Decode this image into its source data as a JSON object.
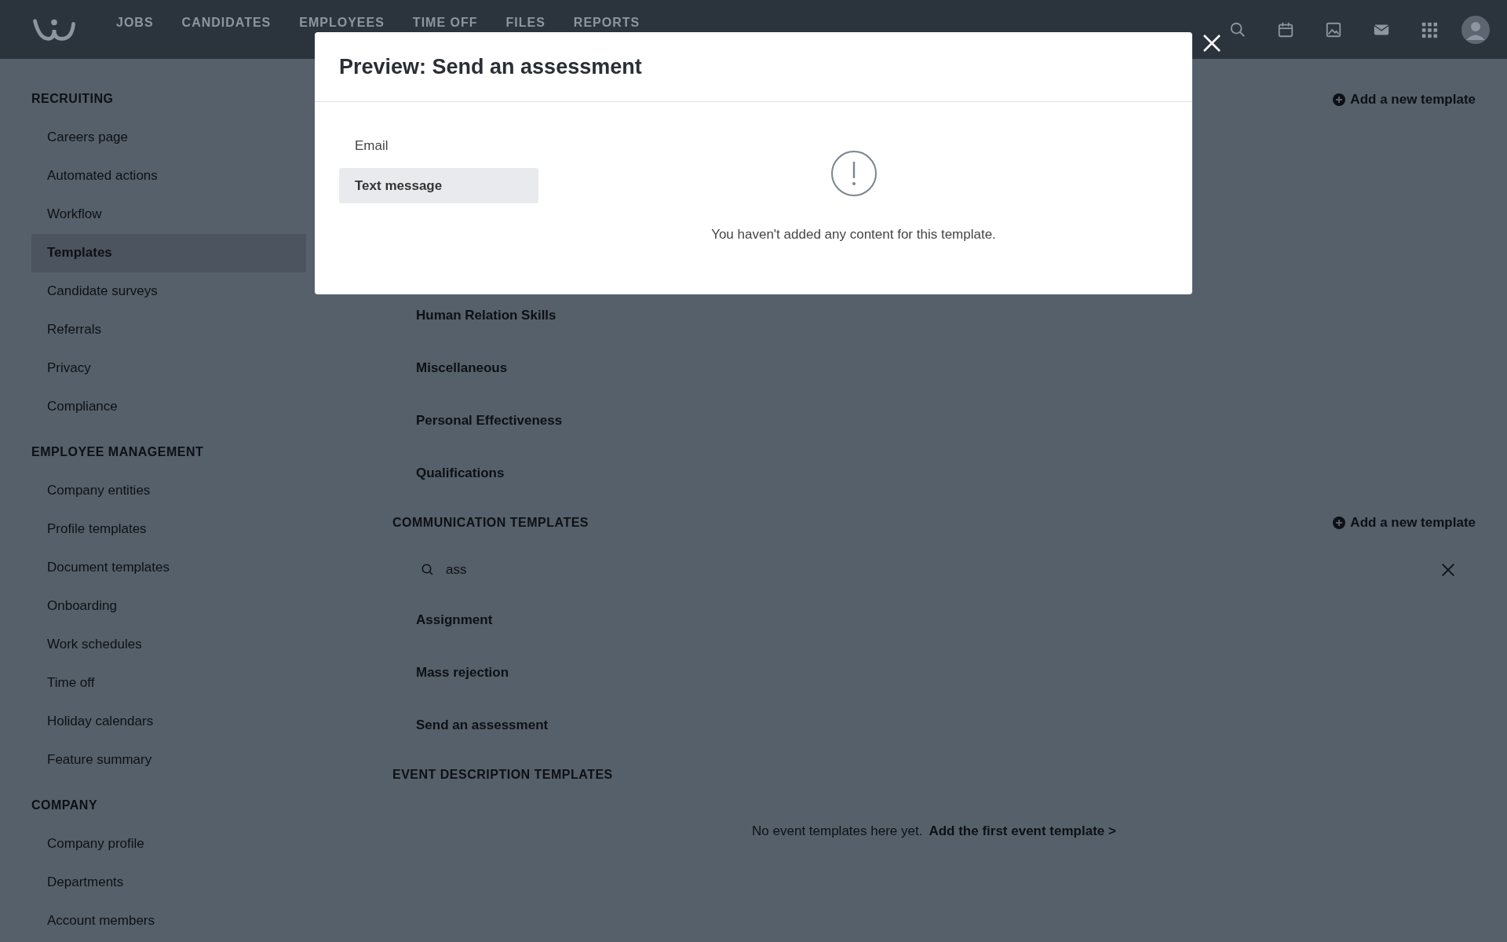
{
  "nav": {
    "items": [
      "JOBS",
      "CANDIDATES",
      "EMPLOYEES",
      "TIME OFF",
      "FILES",
      "REPORTS"
    ]
  },
  "sidebar": {
    "sections": [
      {
        "title": "RECRUITING",
        "items": [
          {
            "label": "Careers page",
            "selected": false
          },
          {
            "label": "Automated actions",
            "selected": false
          },
          {
            "label": "Workflow",
            "selected": false
          },
          {
            "label": "Templates",
            "selected": true
          },
          {
            "label": "Candidate surveys",
            "selected": false
          },
          {
            "label": "Referrals",
            "selected": false
          },
          {
            "label": "Privacy",
            "selected": false
          },
          {
            "label": "Compliance",
            "selected": false
          }
        ]
      },
      {
        "title": "EMPLOYEE MANAGEMENT",
        "items": [
          {
            "label": "Company entities",
            "selected": false
          },
          {
            "label": "Profile templates",
            "selected": false
          },
          {
            "label": "Document templates",
            "selected": false
          },
          {
            "label": "Onboarding",
            "selected": false
          },
          {
            "label": "Work schedules",
            "selected": false
          },
          {
            "label": "Time off",
            "selected": false
          },
          {
            "label": "Holiday calendars",
            "selected": false
          },
          {
            "label": "Feature summary",
            "selected": false
          }
        ]
      },
      {
        "title": "COMPANY",
        "items": [
          {
            "label": "Company profile",
            "selected": false
          },
          {
            "label": "Departments",
            "selected": false
          },
          {
            "label": "Account members",
            "selected": false
          }
        ]
      }
    ]
  },
  "main": {
    "top_add_link": "Add a new template",
    "evaluation_items": [
      "Human Relation Skills",
      "Miscellaneous",
      "Personal Effectiveness",
      "Qualifications"
    ],
    "communication": {
      "title": "COMMUNICATION TEMPLATES",
      "add_link": "Add a new template",
      "search": {
        "value": "ass"
      },
      "items": [
        "Assignment",
        "Mass rejection",
        "Send an assessment"
      ]
    },
    "event": {
      "title": "EVENT DESCRIPTION TEMPLATES",
      "empty_text": "No event templates here yet.",
      "add_link": "Add the first event template >"
    }
  },
  "modal": {
    "title": "Preview: Send an assessment",
    "tabs": [
      {
        "label": "Email",
        "selected": false
      },
      {
        "label": "Text message",
        "selected": true
      }
    ],
    "empty_message": "You haven't added any content for this template."
  }
}
